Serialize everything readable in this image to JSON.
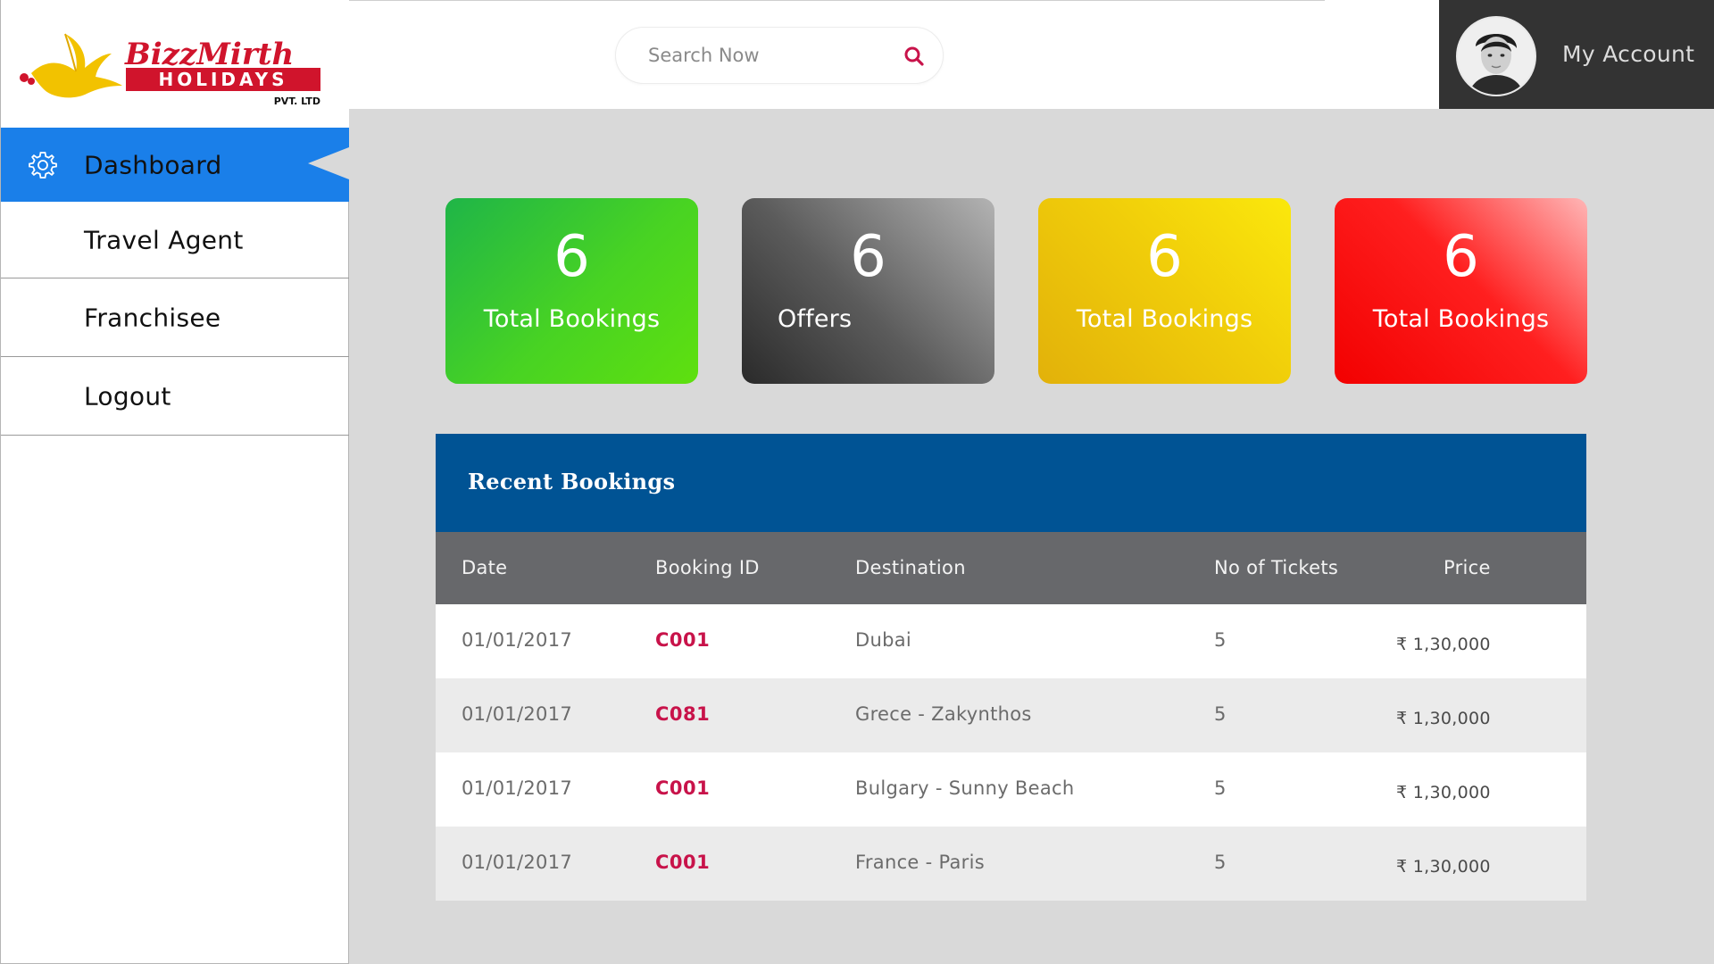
{
  "brand": {
    "name_line1": "BizzMirth",
    "name_line2": "HOLIDAYS",
    "name_line3": "PVT. LTD"
  },
  "sidebar": {
    "items": [
      {
        "label": "Dashboard",
        "icon": "gear-icon",
        "active": true
      },
      {
        "label": "Travel Agent"
      },
      {
        "label": "Franchisee"
      },
      {
        "label": "Logout"
      }
    ]
  },
  "header": {
    "search": {
      "placeholder": "Search Now",
      "value": "",
      "icon": "search-icon"
    },
    "account": {
      "label": "My Account",
      "avatar": "user-avatar"
    }
  },
  "stats": [
    {
      "value": "6",
      "label": "Total Bookings",
      "color": "#2ec43a"
    },
    {
      "value": "6",
      "label": "Offers",
      "color": "#555555"
    },
    {
      "value": "6",
      "label": "Total Bookings",
      "color": "#f0cd0a"
    },
    {
      "value": "6",
      "label": "Total Bookings",
      "color": "#ff1f1f"
    }
  ],
  "recent_bookings": {
    "title": "Recent Bookings",
    "columns": [
      "Date",
      "Booking ID",
      "Destination",
      "No of Tickets",
      "Price"
    ],
    "rows": [
      {
        "date": "01/01/2017",
        "id": "C001",
        "destination": "Dubai",
        "tickets": "5",
        "price": "₹ 1,30,000"
      },
      {
        "date": "01/01/2017",
        "id": "C081",
        "destination": "Grece - Zakynthos",
        "tickets": "5",
        "price": "₹ 1,30,000"
      },
      {
        "date": "01/01/2017",
        "id": "C001",
        "destination": "Bulgary - Sunny Beach",
        "tickets": "5",
        "price": "₹ 1,30,000"
      },
      {
        "date": "01/01/2017",
        "id": "C001",
        "destination": "France - Paris",
        "tickets": "5",
        "price": "₹ 1,30,000"
      }
    ]
  },
  "colors": {
    "sidebar_active": "#1a7fe9",
    "table_title": "#005394",
    "table_header": "#67686b",
    "booking_id": "#c8134a",
    "account_bg": "#333333"
  }
}
